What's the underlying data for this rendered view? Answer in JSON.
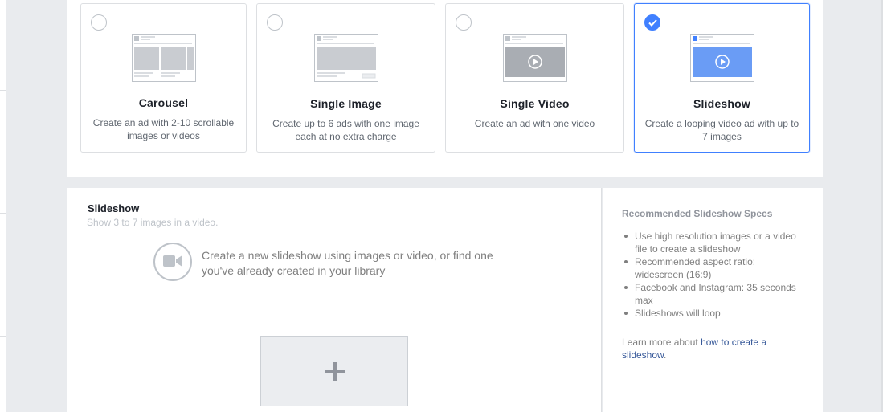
{
  "formats": [
    {
      "title": "Carousel",
      "description": "Create an ad with 2-10 scrollable images or videos",
      "selected": false,
      "thumb_icon": "carousel-icon"
    },
    {
      "title": "Single Image",
      "description": "Create up to 6 ads with one image each at no extra charge",
      "selected": false,
      "thumb_icon": "single-image-icon"
    },
    {
      "title": "Single Video",
      "description": "Create an ad with one video",
      "selected": false,
      "thumb_icon": "single-video-icon"
    },
    {
      "title": "Slideshow",
      "description": "Create a looping video ad with up to 7 images",
      "selected": true,
      "thumb_icon": "slideshow-icon"
    }
  ],
  "slideshow": {
    "title": "Slideshow",
    "subtitle": "Show 3 to 7 images in a video.",
    "create_text": "Create a new slideshow using images or video, or find one you've already created in your library",
    "video_icon": "video-camera-icon",
    "add_icon": "plus-icon"
  },
  "specs": {
    "title": "Recommended Slideshow Specs",
    "items": [
      "Use high resolution images or a video file to create a slideshow",
      "Recommended aspect ratio: widescreen (16:9)",
      "Facebook and Instagram: 35 seconds max",
      "Slideshows will loop"
    ],
    "learn_prefix": "Learn more about ",
    "learn_link": "how to create a slideshow",
    "learn_suffix": "."
  },
  "colors": {
    "accent": "#4080ff",
    "link": "#365899",
    "background": "#e9ebee"
  }
}
